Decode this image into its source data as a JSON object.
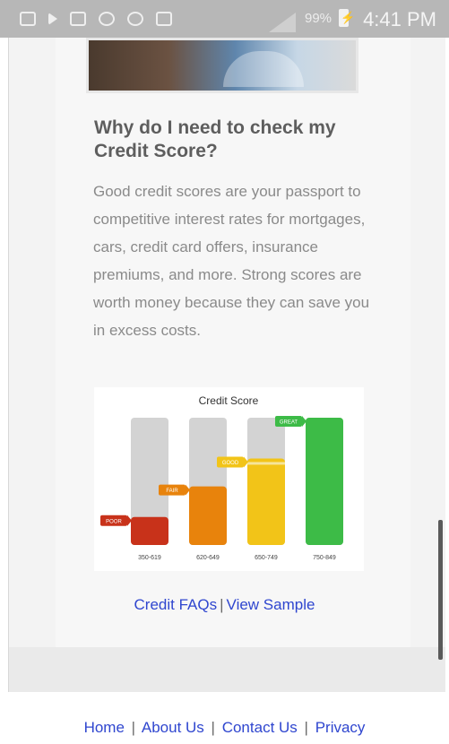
{
  "status_bar": {
    "battery": "99%",
    "time": "4:41 PM",
    "icons": [
      "message-icon",
      "play-icon",
      "file-icon",
      "shield-icon",
      "camera-icon",
      "voicemail-icon"
    ]
  },
  "article": {
    "heading": "Why do I need to check my Credit Score?",
    "body": "Good credit scores are your passport to competitive interest rates for mortgages, cars, credit card offers, insurance premiums, and more. Strong scores are worth money because they can save you in excess costs."
  },
  "chart_data": {
    "type": "bar",
    "title": "Credit Score",
    "categories": [
      "350-619",
      "620-649",
      "650-749",
      "750-849"
    ],
    "labels": [
      "POOR",
      "FAIR",
      "GOOD",
      "GREAT"
    ],
    "fill_fraction": [
      0.22,
      0.46,
      0.68,
      1.0
    ],
    "colors": [
      "#c8321a",
      "#e8830c",
      "#f2c418",
      "#3dbb47"
    ]
  },
  "links": {
    "faq": "Credit FAQs",
    "sample": "View Sample",
    "separator": "|"
  },
  "footer": {
    "home": "Home",
    "about": "About Us",
    "contact": "Contact Us",
    "privacy": "Privacy",
    "separator": "|"
  }
}
